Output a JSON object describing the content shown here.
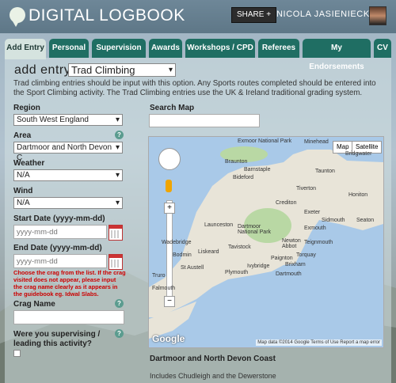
{
  "header": {
    "app_title": "DIGITAL LOGBOOK",
    "share_label": "SHARE +",
    "user_name": "NICOLA JASIENIECKA"
  },
  "tabs": [
    {
      "label": "Add Entry",
      "active": true
    },
    {
      "label": "Personal"
    },
    {
      "label": "Supervision"
    },
    {
      "label": "Awards"
    },
    {
      "label": "Workshops / CPD"
    },
    {
      "label": "Referees"
    },
    {
      "label": "My Endorsements"
    },
    {
      "label": "CV"
    }
  ],
  "entry": {
    "add_entry_label": "add entry",
    "type_value": "Trad Climbing",
    "intro": "Trad climbing entries should be input with this option. Any Sports routes completed should be entered into the Sport Climbing activity. The Trad Climbing entries use the UK & Ireland traditional grading system."
  },
  "form": {
    "region_label": "Region",
    "region_value": "South West England",
    "area_label": "Area",
    "area_value": "Dartmoor and North Devon C",
    "weather_label": "Weather",
    "weather_value": "N/A",
    "wind_label": "Wind",
    "wind_value": "N/A",
    "start_label": "Start Date (yyyy-mm-dd)",
    "start_placeholder": "yyyy-mm-dd",
    "end_label": "End Date (yyyy-mm-dd)",
    "end_placeholder": "yyyy-mm-dd",
    "crag_warning": "Choose the crag from the list. If the crag visited does not appear, please input the crag name clearly as it appears in the guidebook eg. Idwal Slabs.",
    "crag_label": "Crag Name",
    "supervising_label": "Were you supervising / leading this activity?",
    "help_glyph": "?"
  },
  "map": {
    "search_label": "Search Map",
    "map_button": "Map",
    "satellite_button": "Satellite",
    "zoom_in": "+",
    "zoom_out": "−",
    "google": "Google",
    "attribution": "Map data ©2014 Google   Terms of Use   Report a map error",
    "places": [
      "Exmoor National Park",
      "Minehead",
      "Bridgwater",
      "Braunton",
      "Barnstaple",
      "Bideford",
      "Taunton",
      "Tiverton",
      "Honiton",
      "Launceston",
      "Crediton",
      "Exeter",
      "Sidmouth",
      "Seaton",
      "Dartmoor National Park",
      "Exmouth",
      "Newton Abbot",
      "Teignmouth",
      "Wadebridge",
      "Tavistock",
      "Torquay",
      "Bodmin",
      "Liskeard",
      "Paignton",
      "Brixham",
      "Ivybridge",
      "Truro",
      "St Austell",
      "Plymouth",
      "Dartmouth",
      "Falmouth"
    ],
    "area_title": "Dartmoor and North Devon Coast",
    "area_desc": "Includes Chudleigh and the Dewerstone"
  },
  "colors": {
    "header_bg": "#5e7787",
    "tab_bg": "#1f6e63",
    "warning": "#cc0000"
  }
}
